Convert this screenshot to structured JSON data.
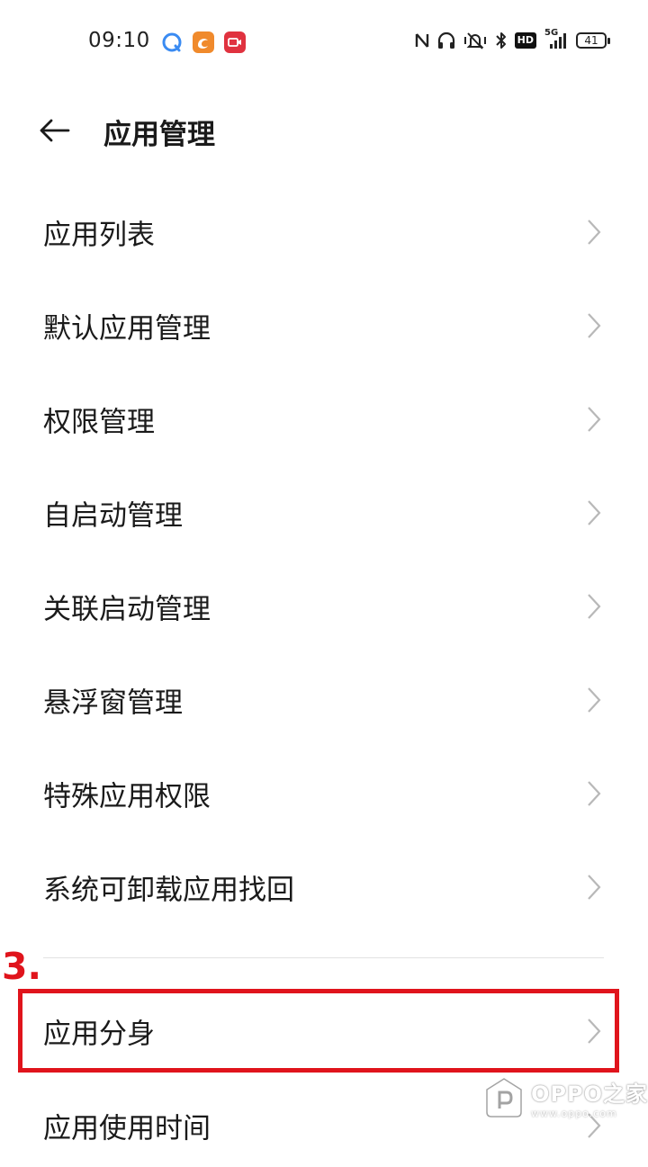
{
  "status_bar": {
    "time": "09:10",
    "notification_icons": [
      "browser-icon",
      "uc-browser-icon",
      "video-call-icon"
    ],
    "hd_label": "HD",
    "network_label": "5G",
    "battery_level": "41"
  },
  "header": {
    "title": "应用管理",
    "back_icon": "back-arrow-icon"
  },
  "menu": {
    "items": [
      {
        "label": "应用列表"
      },
      {
        "label": "默认应用管理"
      },
      {
        "label": "权限管理"
      },
      {
        "label": "自启动管理"
      },
      {
        "label": "关联启动管理"
      },
      {
        "label": "悬浮窗管理"
      },
      {
        "label": "特殊应用权限"
      },
      {
        "label": "系统可卸载应用找回"
      }
    ],
    "clone_item": {
      "label": "应用分身"
    },
    "usage_item": {
      "label": "应用使用时间"
    }
  },
  "annotation": {
    "step": "3.",
    "color": "#e0141c"
  },
  "watermark": {
    "title": "OPPO之家",
    "subtitle": "www.oppo.com"
  }
}
